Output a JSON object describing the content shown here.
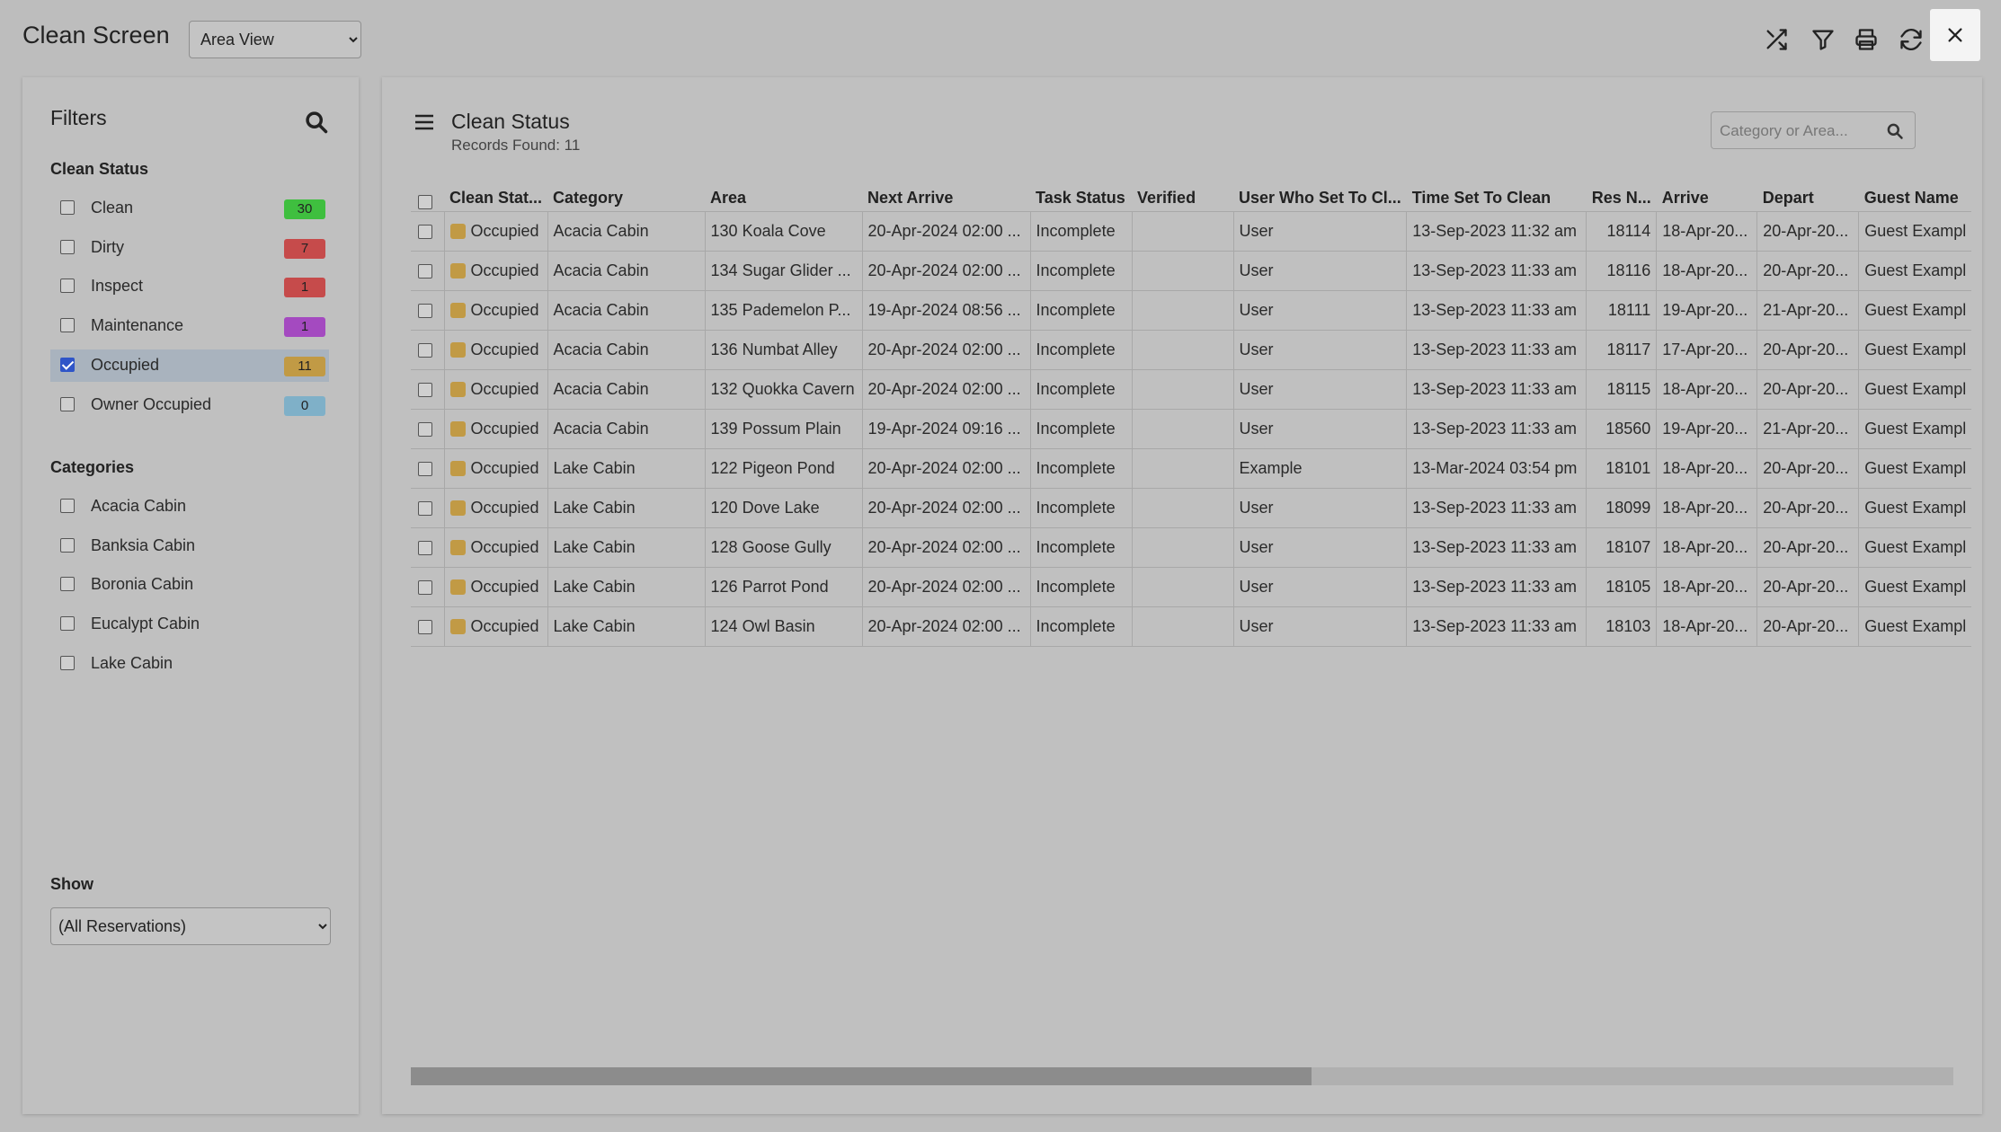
{
  "app": {
    "title": "Clean Screen",
    "view_select": {
      "selected": "Area View"
    }
  },
  "toolbar": {
    "icons": [
      "shuffle-icon",
      "filter-icon",
      "print-icon",
      "refresh-icon",
      "close-icon"
    ]
  },
  "filters": {
    "title": "Filters",
    "clean_status": {
      "label": "Clean Status",
      "items": [
        {
          "label": "Clean",
          "count": "30",
          "color": "#3fbf3f",
          "checked": false
        },
        {
          "label": "Dirty",
          "count": "7",
          "color": "#c64b4b",
          "checked": false
        },
        {
          "label": "Inspect",
          "count": "1",
          "color": "#c64b4b",
          "checked": false
        },
        {
          "label": "Maintenance",
          "count": "1",
          "color": "#a44ac0",
          "checked": false
        },
        {
          "label": "Occupied",
          "count": "11",
          "color": "#c19a45",
          "checked": true
        },
        {
          "label": "Owner Occupied",
          "count": "0",
          "color": "#7fb0c8",
          "checked": false
        }
      ]
    },
    "categories": {
      "label": "Categories",
      "items": [
        {
          "label": "Acacia Cabin"
        },
        {
          "label": "Banksia Cabin"
        },
        {
          "label": "Boronia Cabin"
        },
        {
          "label": "Eucalypt Cabin"
        },
        {
          "label": "Lake Cabin"
        }
      ]
    },
    "show": {
      "label": "Show",
      "selected": "(All Reservations)"
    }
  },
  "main": {
    "title": "Clean Status",
    "records_found": "Records Found: 11",
    "search_placeholder": "Category or Area...",
    "columns": [
      "Clean Stat...",
      "Category",
      "Area",
      "Next Arrive",
      "Task Status",
      "Verified",
      "User Who Set To Cl...",
      "Time Set To Clean",
      "Res N...",
      "Arrive",
      "Depart",
      "Guest Name"
    ],
    "status_color": "#c19a45",
    "rows": [
      [
        "Occupied",
        "Acacia Cabin",
        "130 Koala Cove",
        "20-Apr-2024 02:00 ...",
        "Incomplete",
        "",
        "User",
        "13-Sep-2023 11:32 am",
        "18114",
        "18-Apr-20...",
        "20-Apr-20...",
        "Guest Exampl"
      ],
      [
        "Occupied",
        "Acacia Cabin",
        "134 Sugar Glider ...",
        "20-Apr-2024 02:00 ...",
        "Incomplete",
        "",
        "User",
        "13-Sep-2023 11:33 am",
        "18116",
        "18-Apr-20...",
        "20-Apr-20...",
        "Guest Exampl"
      ],
      [
        "Occupied",
        "Acacia Cabin",
        "135 Pademelon P...",
        "19-Apr-2024 08:56 ...",
        "Incomplete",
        "",
        "User",
        "13-Sep-2023 11:33 am",
        "18111",
        "19-Apr-20...",
        "21-Apr-20...",
        "Guest Exampl"
      ],
      [
        "Occupied",
        "Acacia Cabin",
        "136 Numbat Alley",
        "20-Apr-2024 02:00 ...",
        "Incomplete",
        "",
        "User",
        "13-Sep-2023 11:33 am",
        "18117",
        "17-Apr-20...",
        "20-Apr-20...",
        "Guest Exampl"
      ],
      [
        "Occupied",
        "Acacia Cabin",
        "132 Quokka Cavern",
        "20-Apr-2024 02:00 ...",
        "Incomplete",
        "",
        "User",
        "13-Sep-2023 11:33 am",
        "18115",
        "18-Apr-20...",
        "20-Apr-20...",
        "Guest Exampl"
      ],
      [
        "Occupied",
        "Acacia Cabin",
        "139 Possum Plain",
        "19-Apr-2024 09:16 ...",
        "Incomplete",
        "",
        "User",
        "13-Sep-2023 11:33 am",
        "18560",
        "19-Apr-20...",
        "21-Apr-20...",
        "Guest Exampl"
      ],
      [
        "Occupied",
        "Lake Cabin",
        "122 Pigeon Pond",
        "20-Apr-2024 02:00 ...",
        "Incomplete",
        "",
        "Example",
        "13-Mar-2024 03:54 pm",
        "18101",
        "18-Apr-20...",
        "20-Apr-20...",
        "Guest Exampl"
      ],
      [
        "Occupied",
        "Lake Cabin",
        "120 Dove Lake",
        "20-Apr-2024 02:00 ...",
        "Incomplete",
        "",
        "User",
        "13-Sep-2023 11:33 am",
        "18099",
        "18-Apr-20...",
        "20-Apr-20...",
        "Guest Exampl"
      ],
      [
        "Occupied",
        "Lake Cabin",
        "128 Goose Gully",
        "20-Apr-2024 02:00 ...",
        "Incomplete",
        "",
        "User",
        "13-Sep-2023 11:33 am",
        "18107",
        "18-Apr-20...",
        "20-Apr-20...",
        "Guest Exampl"
      ],
      [
        "Occupied",
        "Lake Cabin",
        "126 Parrot Pond",
        "20-Apr-2024 02:00 ...",
        "Incomplete",
        "",
        "User",
        "13-Sep-2023 11:33 am",
        "18105",
        "18-Apr-20...",
        "20-Apr-20...",
        "Guest Exampl"
      ],
      [
        "Occupied",
        "Lake Cabin",
        "124 Owl Basin",
        "20-Apr-2024 02:00 ...",
        "Incomplete",
        "",
        "User",
        "13-Sep-2023 11:33 am",
        "18103",
        "18-Apr-20...",
        "20-Apr-20...",
        "Guest Exampl"
      ]
    ]
  }
}
